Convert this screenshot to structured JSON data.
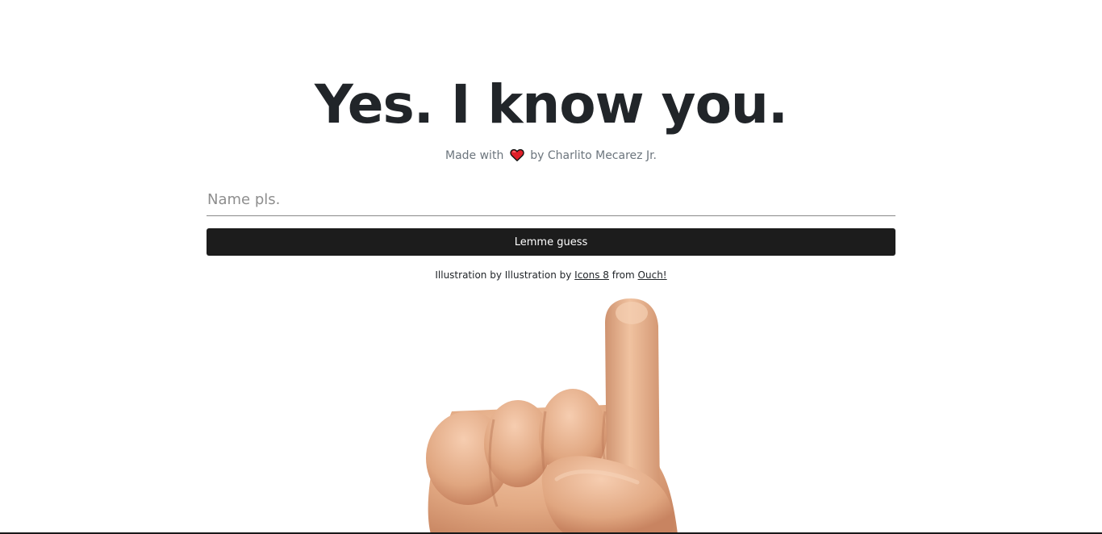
{
  "hero": {
    "title": "Yes. I know you."
  },
  "byline": {
    "prefix": "Made with",
    "icon": "heart-icon",
    "heart_color": "#e0202a",
    "suffix": "by Charlito Mecarez Jr."
  },
  "form": {
    "name_placeholder": "Name pls.",
    "name_value": "",
    "submit_label": "Lemme guess",
    "button_color": "#1c1c1c"
  },
  "credit": {
    "prefix": "Illustration by Illustration by",
    "link1": "Icons 8",
    "middle": "from",
    "link2": "Ouch!"
  },
  "illustration": {
    "icon": "pointing-hand-icon"
  }
}
